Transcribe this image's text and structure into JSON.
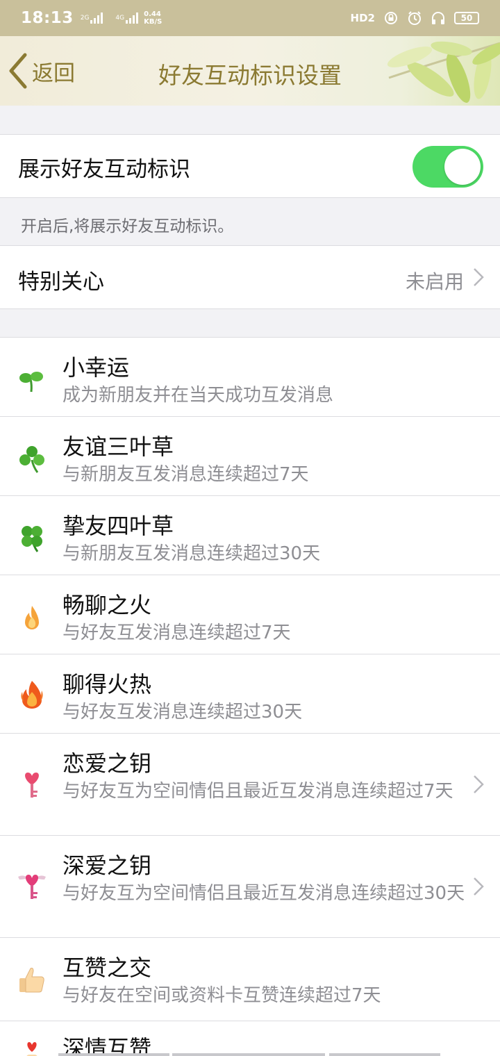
{
  "status_bar": {
    "time": "18:13",
    "sim1": "2G",
    "sim2": "4G",
    "speed_value": "0.44",
    "speed_unit": "KB/S",
    "hd": "HD2",
    "battery": "50"
  },
  "header": {
    "back_label": "返回",
    "title": "好友互动标识设置"
  },
  "settings": {
    "show_label": "展示好友互动标识",
    "toggle_on": true,
    "hint": "开启后,将展示好友互动标识。",
    "special_label": "特别关心",
    "special_status": "未启用"
  },
  "badges": [
    {
      "name": "小幸运",
      "desc": "成为新朋友并在当天成功互发消息",
      "icon": "sprout-icon"
    },
    {
      "name": "友谊三叶草",
      "desc": "与新朋友互发消息连续超过7天",
      "icon": "three-leaf-clover-icon"
    },
    {
      "name": "挚友四叶草",
      "desc": "与新朋友互发消息连续超过30天",
      "icon": "four-leaf-clover-icon"
    },
    {
      "name": "畅聊之火",
      "desc": "与好友互发消息连续超过7天",
      "icon": "small-flame-icon"
    },
    {
      "name": "聊得火热",
      "desc": "与好友互发消息连续超过30天",
      "icon": "big-flame-icon"
    },
    {
      "name": "恋爱之钥",
      "desc": "与好友互为空间情侣且最近互发消息连续超过7天",
      "icon": "heart-key-icon"
    },
    {
      "name": "深爱之钥",
      "desc": "与好友互为空间情侣且最近互发消息连续超过30天",
      "icon": "winged-heart-key-icon"
    },
    {
      "name": "互赞之交",
      "desc": "与好友在空间或资料卡互赞连续超过7天",
      "icon": "thumbs-up-icon"
    },
    {
      "name": "深情互赞",
      "desc": "",
      "icon": "heart-thumbs-icon"
    }
  ],
  "colors": {
    "header_text": "#8b7a32",
    "toggle_on": "#4cd964",
    "status_bar": "#c9c09b"
  }
}
